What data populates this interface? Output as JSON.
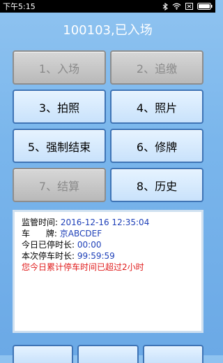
{
  "status_bar": {
    "time": "下午5:15",
    "icons": [
      "bluetooth-icon",
      "wifi-icon",
      "notification-icon",
      "battery-icon"
    ]
  },
  "header": {
    "title": "100103,已入场"
  },
  "buttons": [
    {
      "label": "1、入场",
      "enabled": false
    },
    {
      "label": "2、追缴",
      "enabled": false
    },
    {
      "label": "3、拍照",
      "enabled": true
    },
    {
      "label": "4、照片",
      "enabled": true
    },
    {
      "label": "5、强制结束",
      "enabled": true
    },
    {
      "label": "6、修牌",
      "enabled": true
    },
    {
      "label": "7、结算",
      "enabled": false
    },
    {
      "label": "8、历史",
      "enabled": true
    }
  ],
  "info": {
    "supervise_time_label": "监管时间:",
    "supervise_time_value": "2016-12-16 12:35:04",
    "plate_label": "车      牌:",
    "plate_value": "京ABCDEF",
    "today_parked_label": "今日已停时长:",
    "today_parked_value": "00:00",
    "this_parked_label": "本次停车时长:",
    "this_parked_value": "99:59:59",
    "warning": "您今日累计停车时间已超过2小时"
  },
  "colors": {
    "background": "#7ab6ec",
    "value_text": "#1d3fb8",
    "warning_text": "#e01c1c",
    "button_border": "#3f74b5"
  }
}
